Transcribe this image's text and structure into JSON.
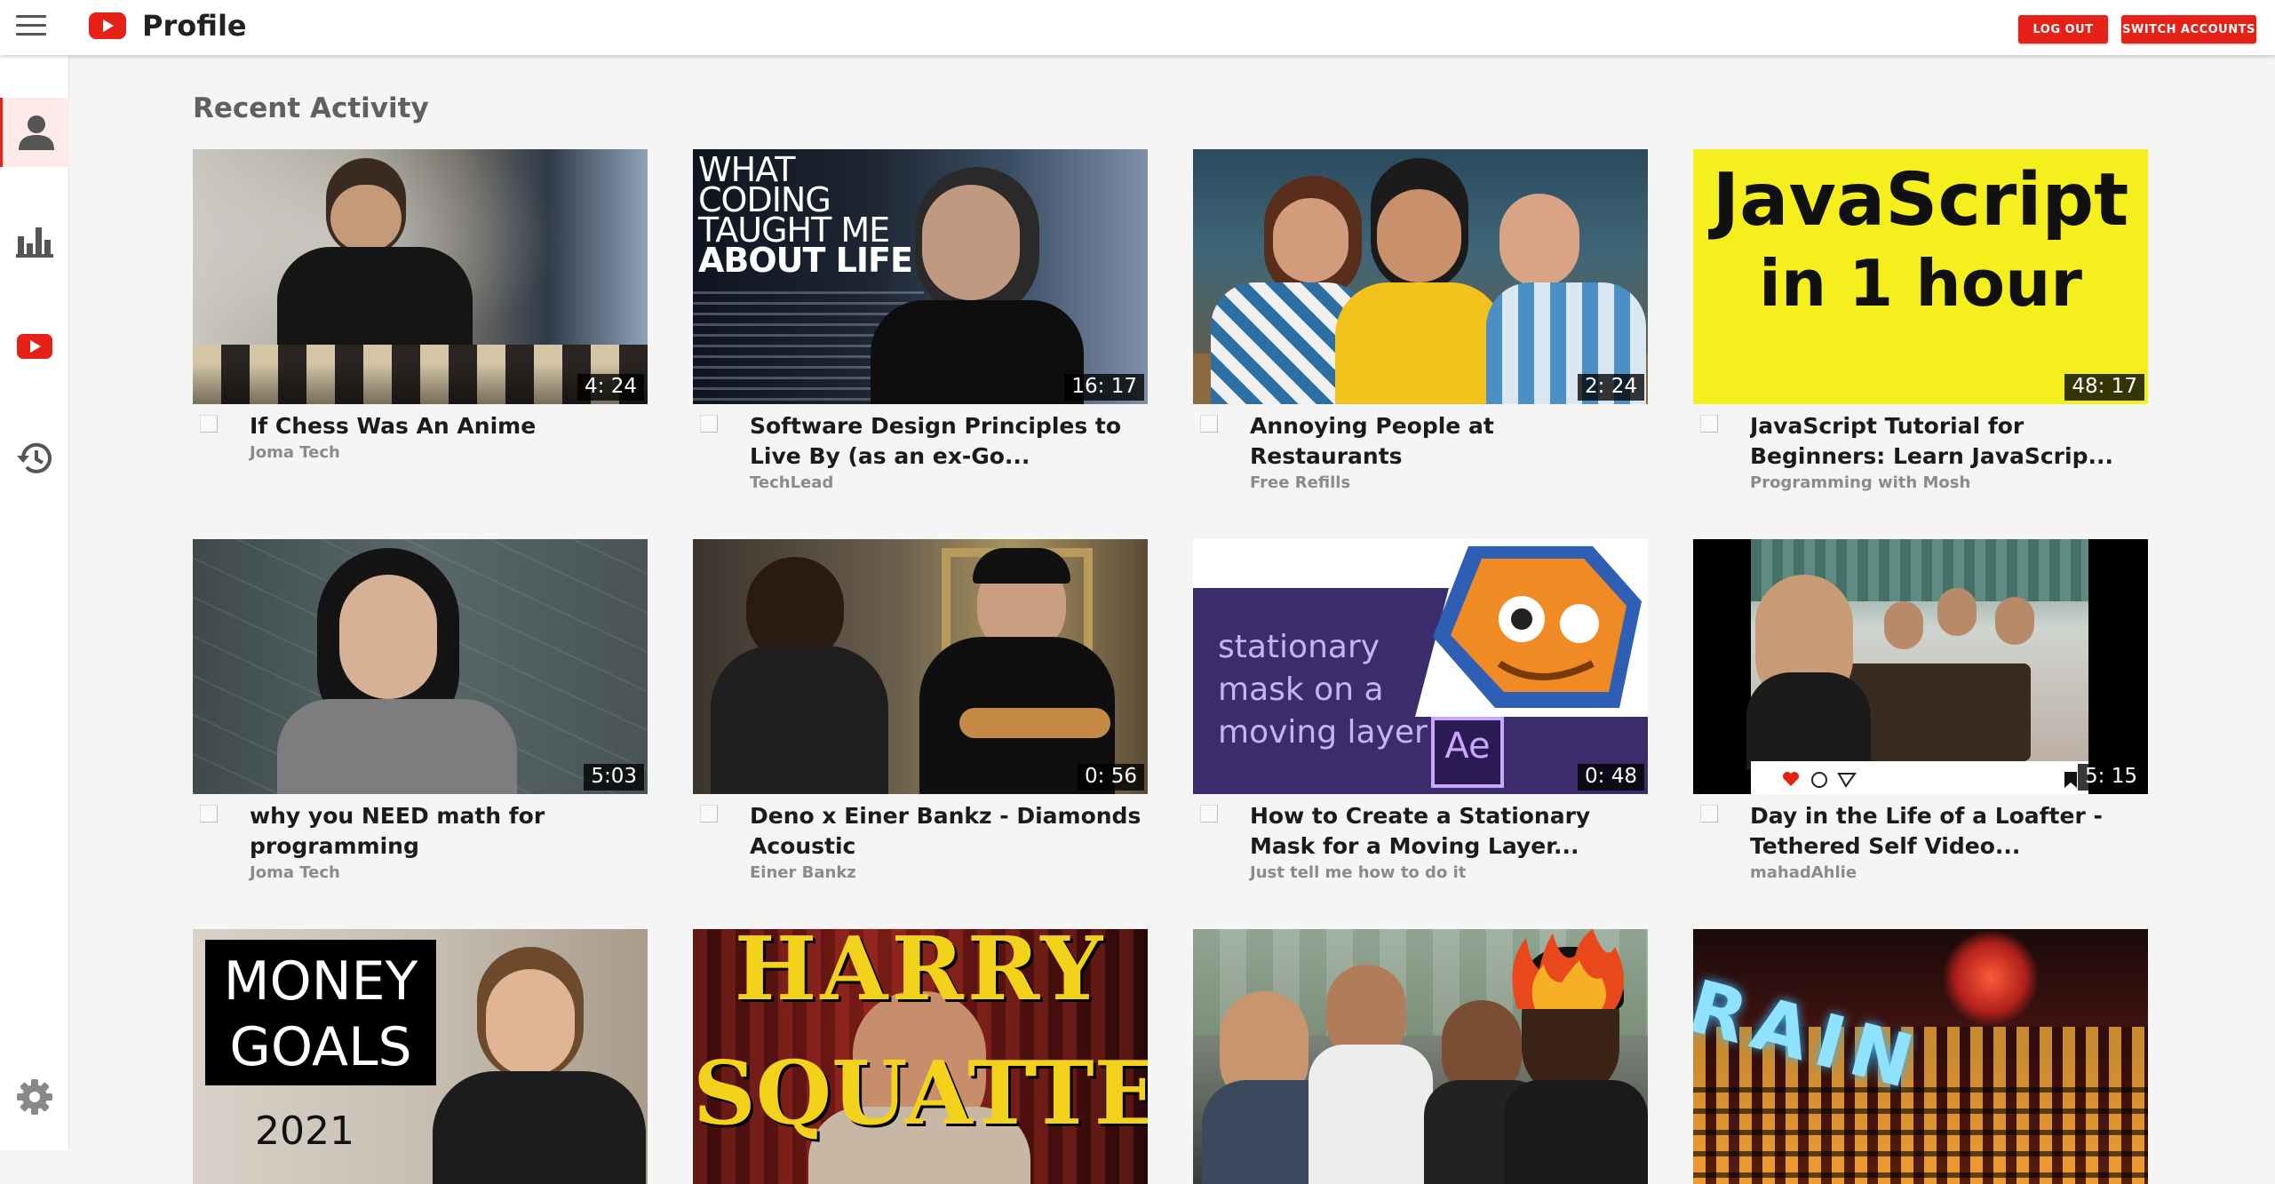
{
  "app": {
    "title": "Profile",
    "icon": "youtube-logo-icon",
    "brand_color": "#e62117"
  },
  "header": {
    "logout_label": "LOG OUT",
    "switch_label": "SWITCH ACCOUNTS"
  },
  "sidebar": {
    "items": [
      {
        "name": "profile",
        "icon": "user-icon",
        "active": true
      },
      {
        "name": "stats",
        "icon": "bar-chart-icon",
        "active": false
      },
      {
        "name": "videos",
        "icon": "youtube-play-icon",
        "active": false
      },
      {
        "name": "history",
        "icon": "history-icon",
        "active": false
      }
    ],
    "settings_icon": "gear-icon"
  },
  "main": {
    "section_title": "Recent Activity",
    "videos": [
      {
        "title": "If Chess Was An Anime",
        "channel": "Joma Tech",
        "duration": "4: 24"
      },
      {
        "title": "Software Design Principles to Live By (as an ex-Go...",
        "channel": "TechLead",
        "duration": "16: 17",
        "thumb_text": [
          "WHAT",
          "CODING",
          "TAUGHT ME",
          "ABOUT LIFE"
        ]
      },
      {
        "title": "Annoying People at Restaurants",
        "channel": "Free Refills",
        "duration": "2: 24"
      },
      {
        "title": "JavaScript Tutorial for Beginners: Learn JavaScrip...",
        "channel": "Programming with Mosh",
        "duration": "48: 17",
        "thumb_text": [
          "JavaScript",
          "in 1 hour"
        ]
      },
      {
        "title": "why you NEED math for programming",
        "channel": "Joma Tech",
        "duration": "5:03"
      },
      {
        "title": "Deno x Einer Bankz - Diamonds Acoustic",
        "channel": "Einer Bankz",
        "duration": "0: 56"
      },
      {
        "title": "How to Create a Stationary Mask for a Moving Layer...",
        "channel": "Just tell me how to do it",
        "duration": "0: 48",
        "thumb_text": [
          "stationary",
          "mask on a",
          "moving layer",
          "Ae"
        ]
      },
      {
        "title": "Day in the Life of a Loafter - Tethered Self Video...",
        "channel": "mahadAhlie",
        "duration": "5: 15"
      },
      {
        "title": "",
        "channel": "",
        "duration": "",
        "thumb_text": [
          "MONEY",
          "GOALS",
          "2021"
        ]
      },
      {
        "title": "",
        "channel": "",
        "duration": "",
        "thumb_text": [
          "HARRY",
          "SQUATTER"
        ]
      },
      {
        "title": "",
        "channel": "",
        "duration": ""
      },
      {
        "title": "",
        "channel": "",
        "duration": "",
        "thumb_text": [
          "RAIN"
        ]
      }
    ]
  }
}
